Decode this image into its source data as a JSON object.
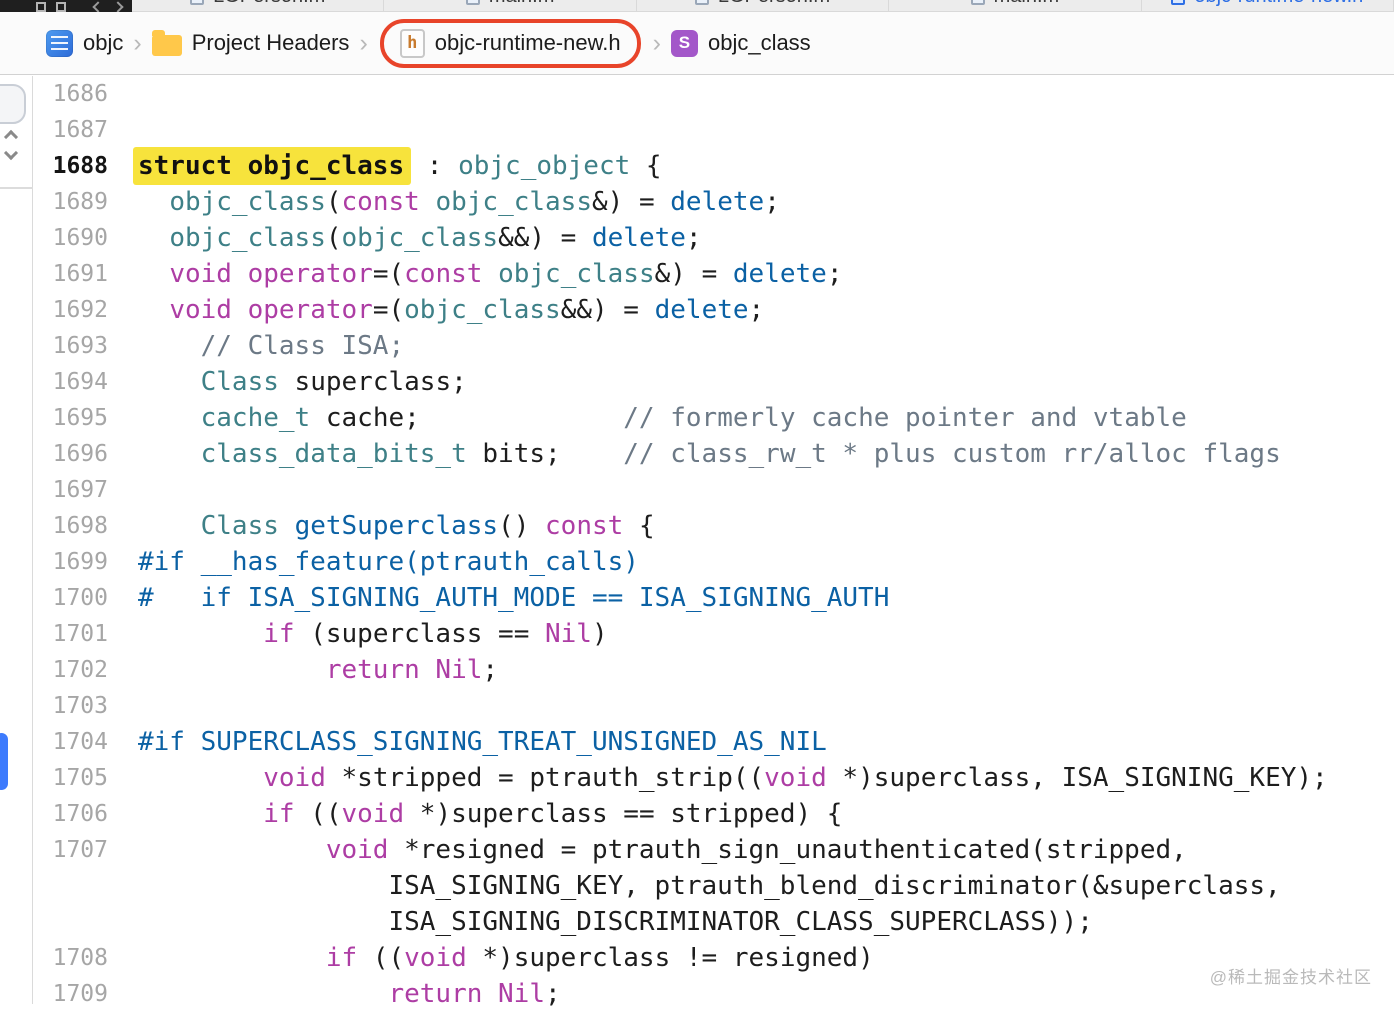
{
  "tab_bar": {
    "tabs": [
      {
        "label": "LGPerson.m",
        "active": false
      },
      {
        "label": "main.m",
        "active": false
      },
      {
        "label": "LGPerson.m",
        "active": false
      },
      {
        "label": "main.m",
        "active": false
      },
      {
        "label": "objc-runtime-new.h",
        "active": true
      }
    ]
  },
  "breadcrumb": {
    "separator": "›",
    "items": [
      {
        "label": "objc",
        "icon": "project-icon"
      },
      {
        "label": "Project Headers",
        "icon": "folder-icon"
      },
      {
        "label": "objc-runtime-new.h",
        "icon": "header-file-icon",
        "icon_letter": "h",
        "annotated": true
      },
      {
        "label": "objc_class",
        "icon": "struct-icon",
        "icon_letter": "S"
      }
    ]
  },
  "annotation": {
    "shape": "rounded-rect-outline",
    "color": "#e8442a",
    "target": "objc-runtime-new.h"
  },
  "highlight": {
    "text": "struct objc_class",
    "background": "#f7e33c"
  },
  "watermark": "@稀土掘金技术社区",
  "colors": {
    "keyword": "#ad3da4",
    "type": "#3e8087",
    "function_and_preprocessor": "#0b61a4",
    "comment": "#6c7986",
    "plain": "#1d1d1d",
    "line_number": "#a6a6a6",
    "active_line_number": "#141414",
    "annotation": "#e8442a",
    "highlight_bg": "#f7e33c",
    "active_tab": "#2e6fe5",
    "blue_pill": "#3d7bfd"
  },
  "editor": {
    "lines": [
      {
        "num": "1686",
        "segments": []
      },
      {
        "num": "1687",
        "segments": []
      },
      {
        "num": "1688",
        "active": true,
        "segments": [
          {
            "s": "h",
            "t": "struct objc_class"
          },
          {
            "s": "p",
            "t": " : "
          },
          {
            "s": "t",
            "t": "objc_object"
          },
          {
            "s": "p",
            "t": " {"
          }
        ]
      },
      {
        "num": "1689",
        "segments": [
          {
            "s": "p",
            "t": "  "
          },
          {
            "s": "t",
            "t": "objc_class"
          },
          {
            "s": "p",
            "t": "("
          },
          {
            "s": "k",
            "t": "const"
          },
          {
            "s": "p",
            "t": " "
          },
          {
            "s": "t",
            "t": "objc_class"
          },
          {
            "s": "p",
            "t": "&) = "
          },
          {
            "s": "b",
            "t": "delete"
          },
          {
            "s": "p",
            "t": ";"
          }
        ]
      },
      {
        "num": "1690",
        "segments": [
          {
            "s": "p",
            "t": "  "
          },
          {
            "s": "t",
            "t": "objc_class"
          },
          {
            "s": "p",
            "t": "("
          },
          {
            "s": "t",
            "t": "objc_class"
          },
          {
            "s": "p",
            "t": "&&) = "
          },
          {
            "s": "b",
            "t": "delete"
          },
          {
            "s": "p",
            "t": ";"
          }
        ]
      },
      {
        "num": "1691",
        "segments": [
          {
            "s": "p",
            "t": "  "
          },
          {
            "s": "k",
            "t": "void"
          },
          {
            "s": "p",
            "t": " "
          },
          {
            "s": "k",
            "t": "operator"
          },
          {
            "s": "p",
            "t": "=("
          },
          {
            "s": "k",
            "t": "const"
          },
          {
            "s": "p",
            "t": " "
          },
          {
            "s": "t",
            "t": "objc_class"
          },
          {
            "s": "p",
            "t": "&) = "
          },
          {
            "s": "b",
            "t": "delete"
          },
          {
            "s": "p",
            "t": ";"
          }
        ]
      },
      {
        "num": "1692",
        "segments": [
          {
            "s": "p",
            "t": "  "
          },
          {
            "s": "k",
            "t": "void"
          },
          {
            "s": "p",
            "t": " "
          },
          {
            "s": "k",
            "t": "operator"
          },
          {
            "s": "p",
            "t": "=("
          },
          {
            "s": "t",
            "t": "objc_class"
          },
          {
            "s": "p",
            "t": "&&) = "
          },
          {
            "s": "b",
            "t": "delete"
          },
          {
            "s": "p",
            "t": ";"
          }
        ]
      },
      {
        "num": "1693",
        "segments": [
          {
            "s": "p",
            "t": "    "
          },
          {
            "s": "c",
            "t": "// Class ISA;"
          }
        ]
      },
      {
        "num": "1694",
        "segments": [
          {
            "s": "p",
            "t": "    "
          },
          {
            "s": "t",
            "t": "Class"
          },
          {
            "s": "p",
            "t": " superclass;"
          }
        ]
      },
      {
        "num": "1695",
        "segments": [
          {
            "s": "p",
            "t": "    "
          },
          {
            "s": "t",
            "t": "cache_t"
          },
          {
            "s": "p",
            "t": " cache;             "
          },
          {
            "s": "c",
            "t": "// formerly cache pointer and vtable"
          }
        ]
      },
      {
        "num": "1696",
        "segments": [
          {
            "s": "p",
            "t": "    "
          },
          {
            "s": "t",
            "t": "class_data_bits_t"
          },
          {
            "s": "p",
            "t": " bits;    "
          },
          {
            "s": "c",
            "t": "// class_rw_t * plus custom rr/alloc flags"
          }
        ]
      },
      {
        "num": "1697",
        "segments": []
      },
      {
        "num": "1698",
        "segments": [
          {
            "s": "p",
            "t": "    "
          },
          {
            "s": "t",
            "t": "Class"
          },
          {
            "s": "p",
            "t": " "
          },
          {
            "s": "b",
            "t": "getSuperclass"
          },
          {
            "s": "p",
            "t": "() "
          },
          {
            "s": "k",
            "t": "const"
          },
          {
            "s": "p",
            "t": " {"
          }
        ]
      },
      {
        "num": "1699",
        "segments": [
          {
            "s": "b",
            "t": "#if __has_feature(ptrauth_calls)"
          }
        ]
      },
      {
        "num": "1700",
        "segments": [
          {
            "s": "b",
            "t": "#   if ISA_SIGNING_AUTH_MODE == ISA_SIGNING_AUTH"
          }
        ]
      },
      {
        "num": "1701",
        "segments": [
          {
            "s": "p",
            "t": "        "
          },
          {
            "s": "k",
            "t": "if"
          },
          {
            "s": "p",
            "t": " (superclass == "
          },
          {
            "s": "k",
            "t": "Nil"
          },
          {
            "s": "p",
            "t": ")"
          }
        ]
      },
      {
        "num": "1702",
        "segments": [
          {
            "s": "p",
            "t": "            "
          },
          {
            "s": "k",
            "t": "return"
          },
          {
            "s": "p",
            "t": " "
          },
          {
            "s": "k",
            "t": "Nil"
          },
          {
            "s": "p",
            "t": ";"
          }
        ]
      },
      {
        "num": "1703",
        "segments": []
      },
      {
        "num": "1704",
        "segments": [
          {
            "s": "b",
            "t": "#if SUPERCLASS_SIGNING_TREAT_UNSIGNED_AS_NIL"
          }
        ]
      },
      {
        "num": "1705",
        "segments": [
          {
            "s": "p",
            "t": "        "
          },
          {
            "s": "k",
            "t": "void"
          },
          {
            "s": "p",
            "t": " *stripped = ptrauth_strip(("
          },
          {
            "s": "k",
            "t": "void"
          },
          {
            "s": "p",
            "t": " *)superclass, ISA_SIGNING_KEY);"
          }
        ]
      },
      {
        "num": "1706",
        "segments": [
          {
            "s": "p",
            "t": "        "
          },
          {
            "s": "k",
            "t": "if"
          },
          {
            "s": "p",
            "t": " (("
          },
          {
            "s": "k",
            "t": "void"
          },
          {
            "s": "p",
            "t": " *)superclass == stripped) {"
          }
        ]
      },
      {
        "num": "1707",
        "segments": [
          {
            "s": "p",
            "t": "            "
          },
          {
            "s": "k",
            "t": "void"
          },
          {
            "s": "p",
            "t": " *resigned = ptrauth_sign_unauthenticated(stripped,"
          }
        ]
      },
      {
        "num": "",
        "segments": [
          {
            "s": "p",
            "t": "                ISA_SIGNING_KEY, ptrauth_blend_discriminator(&superclass,"
          }
        ]
      },
      {
        "num": "",
        "segments": [
          {
            "s": "p",
            "t": "                ISA_SIGNING_DISCRIMINATOR_CLASS_SUPERCLASS));"
          }
        ]
      },
      {
        "num": "1708",
        "segments": [
          {
            "s": "p",
            "t": "            "
          },
          {
            "s": "k",
            "t": "if"
          },
          {
            "s": "p",
            "t": " (("
          },
          {
            "s": "k",
            "t": "void"
          },
          {
            "s": "p",
            "t": " *)superclass != resigned)"
          }
        ]
      },
      {
        "num": "1709",
        "segments": [
          {
            "s": "p",
            "t": "                "
          },
          {
            "s": "k",
            "t": "return"
          },
          {
            "s": "p",
            "t": " "
          },
          {
            "s": "k",
            "t": "Nil"
          },
          {
            "s": "p",
            "t": ";"
          }
        ]
      }
    ]
  }
}
